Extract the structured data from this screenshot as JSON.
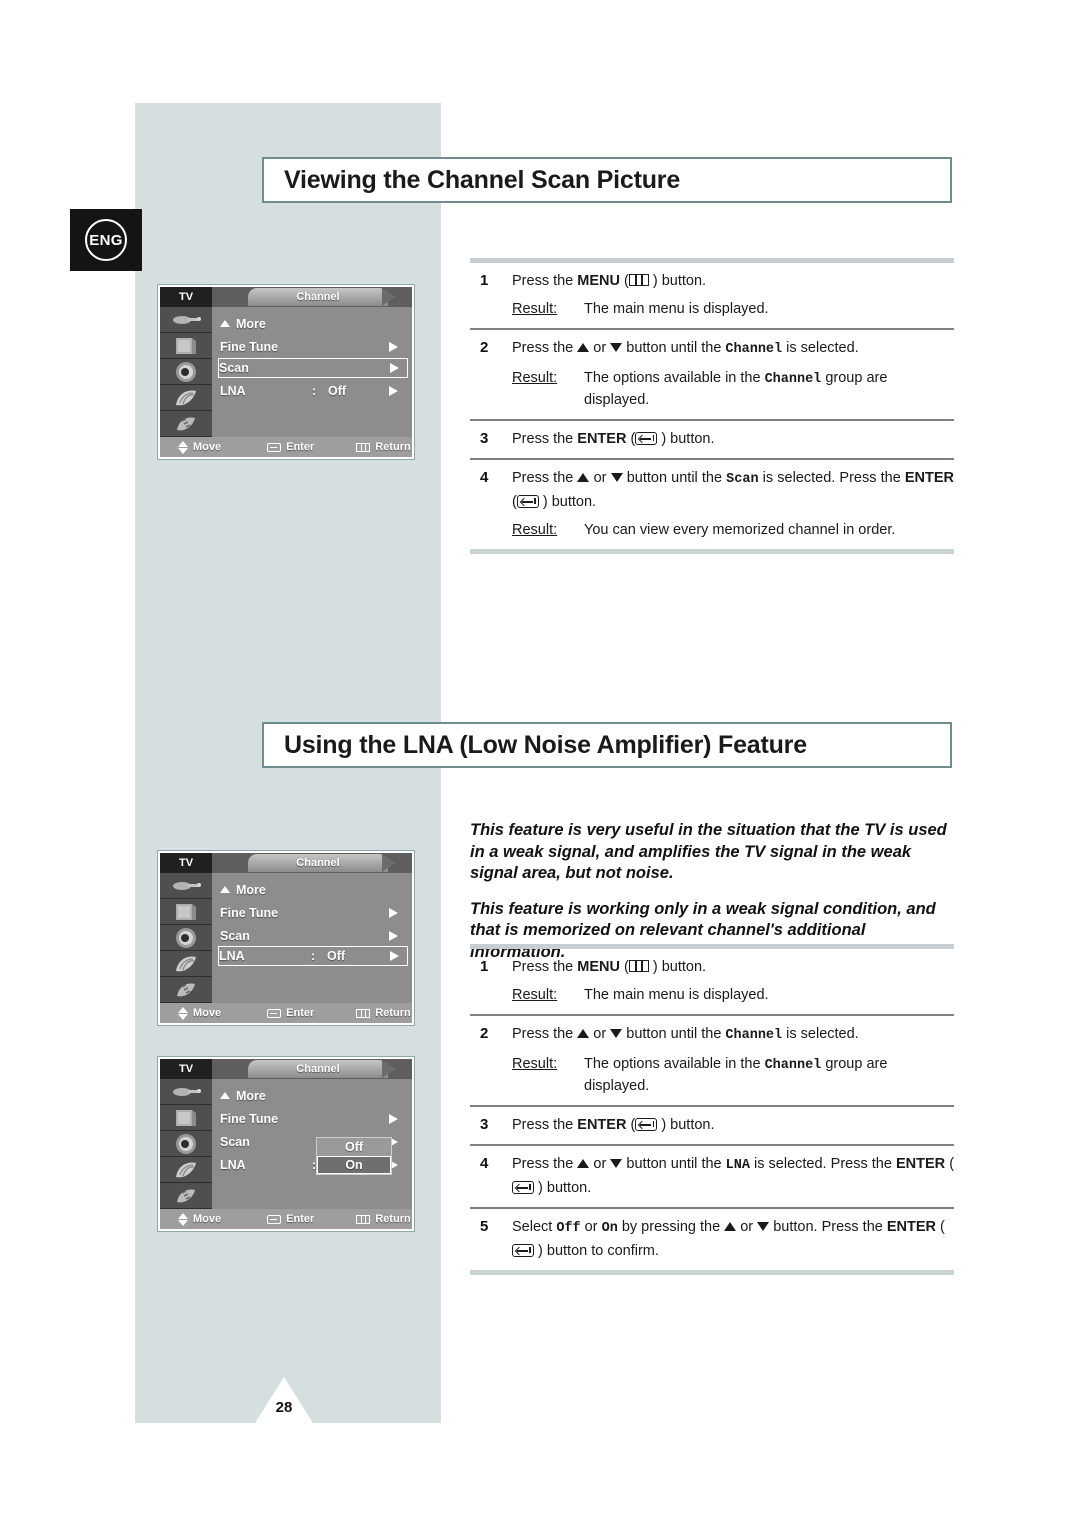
{
  "page": {
    "number": "28",
    "language_badge": "ENG"
  },
  "sections": [
    {
      "title": "Viewing the Channel Scan Picture",
      "steps": [
        {
          "num": "1",
          "text_before": "Press the ",
          "bold": "MENU",
          "icon": "menu-icon",
          "text_after": " ) button.",
          "result_label": "Result:",
          "result_text": "The main menu is displayed."
        },
        {
          "num": "2",
          "text_before": "Press the ",
          "mid": " or ",
          "text_after": " button until the ",
          "mono": "Channel",
          "tail": " is selected.",
          "result_label": "Result:",
          "result_text_a": "The options available in the ",
          "result_mono": "Channel",
          "result_text_b": " group are displayed."
        },
        {
          "num": "3",
          "text_before": "Press the ",
          "bold": "ENTER",
          "icon": "enter-icon",
          "text_after": " ) button."
        },
        {
          "num": "4",
          "text_before": "Press the ",
          "mid": " or ",
          "text_after": " button until the ",
          "mono": "Scan",
          "tail": " is selected. Press the ",
          "bold2": "ENTER",
          "tail2": " ) button.",
          "result_label": "Result:",
          "result_text": "You can view every memorized channel in order."
        }
      ]
    },
    {
      "title": "Using the LNA (Low Noise Amplifier) Feature",
      "intro": [
        "This feature is very useful in the situation that the TV is used in a weak signal, and amplifies the TV signal in the weak signal area, but not noise.",
        "This feature is working only in a weak signal condition, and that is memorized on relevant channel's additional information."
      ],
      "steps": [
        {
          "num": "1",
          "text_before": "Press the ",
          "bold": "MENU",
          "icon": "menu-icon",
          "text_after": " ) button.",
          "result_label": "Result:",
          "result_text": "The main menu is displayed."
        },
        {
          "num": "2",
          "text_before": "Press the ",
          "mid": " or ",
          "text_after": " button until the ",
          "mono": "Channel",
          "tail": " is selected.",
          "result_label": "Result:",
          "result_text_a": "The options available in the ",
          "result_mono": "Channel",
          "result_text_b": " group are displayed."
        },
        {
          "num": "3",
          "text_before": "Press the ",
          "bold": "ENTER",
          "icon": "enter-icon",
          "text_after": " ) button."
        },
        {
          "num": "4",
          "text_before": "Press the ",
          "mid": " or ",
          "text_after": " button until the ",
          "mono": "LNA",
          "tail": " is selected. Press the ",
          "bold2": "ENTER",
          "tail2": " ) button."
        },
        {
          "num": "5",
          "text_before": "Select ",
          "mono": "Off",
          "mid": " or ",
          "mono2": "On",
          "text_after": " by pressing the ",
          "mid2": " or ",
          "tail": " button. Press the ",
          "bold2": "ENTER",
          "tail2": " ) button to confirm."
        }
      ]
    }
  ],
  "osd": {
    "tv_label": "TV",
    "tab_label": "Channel",
    "rows": {
      "more": "More",
      "fine_tune": "Fine Tune",
      "scan": "Scan",
      "lna": "LNA",
      "colon": ":",
      "lna_value": "Off"
    },
    "options": {
      "off": "Off",
      "on": "On"
    },
    "footer": {
      "move": "Move",
      "enter": "Enter",
      "return": "Return"
    },
    "sidebar_icons": [
      "antenna-icon",
      "picture-icon",
      "sound-icon",
      "setup-icon",
      "pc-icon"
    ]
  },
  "colors": {
    "band": "#d5dfe0",
    "title_border": "#6f8d90",
    "separator_thin": "#7c8184",
    "separator_thick": "#c8cdd1",
    "osd_body": "#8d8d8d"
  }
}
